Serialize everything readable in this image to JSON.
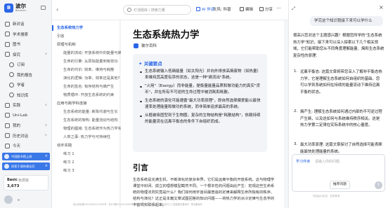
{
  "brand": {
    "name": "波尔",
    "sub": "Bohrium"
  },
  "nav": [
    {
      "label": "新对话",
      "icon": "plus-icon",
      "sub": false,
      "chev": ""
    },
    {
      "label": "学术搜索",
      "icon": "search-icon",
      "sub": false,
      "chev": ""
    },
    {
      "label": "图书",
      "icon": "book-icon",
      "sub": false,
      "chev": ""
    },
    {
      "label": "探究",
      "icon": "compass-icon",
      "sub": false,
      "chev": "∨"
    },
    {
      "label": "订阅",
      "icon": "bell-icon",
      "sub": true,
      "chev": ""
    },
    {
      "label": "我的报告",
      "icon": "report-icon",
      "sub": true,
      "chev": ""
    },
    {
      "label": "学者",
      "icon": "user-icon",
      "sub": true,
      "chev": ""
    },
    {
      "label": "知识库",
      "icon": "library-icon",
      "sub": true,
      "chev": ""
    },
    {
      "label": "实践",
      "icon": "flask-icon",
      "sub": false,
      "chev": "∨"
    },
    {
      "label": "Uni-Lab",
      "icon": "lab-icon",
      "sub": false,
      "chev": ""
    },
    {
      "label": "我的",
      "icon": "person-icon",
      "sub": false,
      "chev": "∨"
    },
    {
      "label": "历史对话",
      "icon": "history-icon",
      "sub": false,
      "chev": ">"
    },
    {
      "label": "今天",
      "icon": "clock-icon",
      "sub": false,
      "chev": ""
    },
    {
      "label": "概念图表示态...",
      "icon": "doc-icon",
      "sub": false,
      "chev": ""
    }
  ],
  "banners": [
    {
      "label": "中国图书馆上线"
    },
    {
      "label": "探索于湖岸建议后"
    }
  ],
  "plan": {
    "name": "Basic",
    "price": "免费版",
    "count": "3,673"
  },
  "toolbar": {
    "back": "‹",
    "search_placeholder": "灯泡题库 / 搜索力量",
    "listen": "AI 伴读",
    "field": "文风: 科普",
    "edit": "编辑",
    "share": "分享",
    "export": "导出",
    "more": "···"
  },
  "toc": {
    "items": [
      {
        "label": "生态系统热力学",
        "level": 1,
        "active": true
      },
      {
        "label": "引言",
        "level": 1,
        "active": false
      },
      {
        "label": "原理与机制",
        "level": 1,
        "active": false
      },
      {
        "label": "能量的流动: 开放系统中的能量与熵",
        "level": 2,
        "active": false
      },
      {
        "label": "生命的引擎: 从原始能量到有效功",
        "level": 2,
        "active": false
      },
      {
        "label": "生命的代价: 效率、维持与耗散",
        "level": 2,
        "active": false
      },
      {
        "label": "演化的逻辑: 功率、效率还是其他?",
        "level": 2,
        "active": false
      },
      {
        "label": "生命的签名: 有序结构与熵产生",
        "level": 2,
        "active": false
      },
      {
        "label": "物质循环: 开放生态系统的约束",
        "level": 2,
        "active": false
      },
      {
        "label": "应用与跨学科连接",
        "level": 1,
        "active": false
      },
      {
        "label": "生态系统的能量: 新陈代谢与生长",
        "level": 2,
        "active": false
      },
      {
        "label": "生态系统的架构: 能量流动与结构",
        "level": 2,
        "active": false
      },
      {
        "label": "物理的疆域: 生态系统作为热力学实体",
        "level": 2,
        "active": false
      },
      {
        "label": "人类之事: 热力学与可持续性",
        "level": 2,
        "active": false
      },
      {
        "label": "动手实践",
        "level": 1,
        "active": false
      },
      {
        "label": "练习 1",
        "level": 2,
        "active": false
      },
      {
        "label": "练习 2",
        "level": 2,
        "active": false
      },
      {
        "label": "练习 3",
        "level": 2,
        "active": false
      }
    ]
  },
  "article": {
    "title": "生态系统热力学",
    "author": "玻尔百科",
    "key_title": "✦ 关键要点",
    "key_points": [
      "生态系统输入低熵能量（如太阳光）并向外排放高熵废物（如热量）来维持其高度有序的状态，这是一种\"熵流出\"系统。",
      "\"火用\"（Exergy）而非能量，是衡量能量品质和做功能力的真实\"货币\"，并在所有不可逆的生命过程中被消耗和耗散。",
      "生态系统的演化可能遵循\"最大功率原理\"，即自然选择偏爱能以最快速率处理能量和做功的系统，而非简单追求最高的系统。",
      "从植被吸固型到于生物圈，复杂的生物结构是\"耗散结构\"，依赖持续的能量流在远离平衡态的条件下自组织而成。"
    ],
    "section_title": "引言",
    "intro": "生态系统是充满生机、不断演化的复杂世界。它们是远离平衡的开放系统。这与物理学课堂中封闭、孤立的理想模型截然不同。一个根本性的问题由此产生：宏观这些生命系统的物理法则究竟是什么？我们如何用宇宙间最普适的定律来解释生命所独有的秩序、结构与演化？这正是本篇文章试图回答的知识问题——将热力学的冰冷定律与生态学的丰富现实联系起来。"
  },
  "assistant": {
    "question": "学完这个知识我接下来可以学什么",
    "reply": "很高兴您对这个主题感兴趣！根据您所学的\"生态系统热力学\"知识，接下来可以深入探索以下几个相关领域，它们能帮助您从不同角度理解能量、熵和生态系统复杂性的原理：",
    "items": [
      {
        "num": "1.",
        "text": "远离平衡态: 这篇文章将带您深入了解非平衡态热力学，它是理解生态系统如何自组织的基础。您可以学到系统如何在持续的能量流动下维持远离平衡的状态。"
      },
      {
        "num": "2.",
        "text": "熵产生: 理解生态系统如何通过内部的不可逆过程产生熵，以及这如何与系统维持秩序相关。这是热力学第二定律在实际系统中的核心量度。"
      },
      {
        "num": "3.",
        "text": "最大功率原理: 这篇文章探讨了自然选择可能青睐能最快处理能量的系统。"
      }
    ],
    "input_tag": "学习伴读",
    "input_placeholder": "请输入你的问题",
    "recommend_btn": "推荐问题",
    "send": "↑",
    "note": "内容由AI生成，仅供参考"
  },
  "footer": "浙公网安备33010802013260号 · 浙ICP备2023014063号 · 增值电信业务经营许可证 · 生成式人工智能服务备案号 · 算法备案号"
}
